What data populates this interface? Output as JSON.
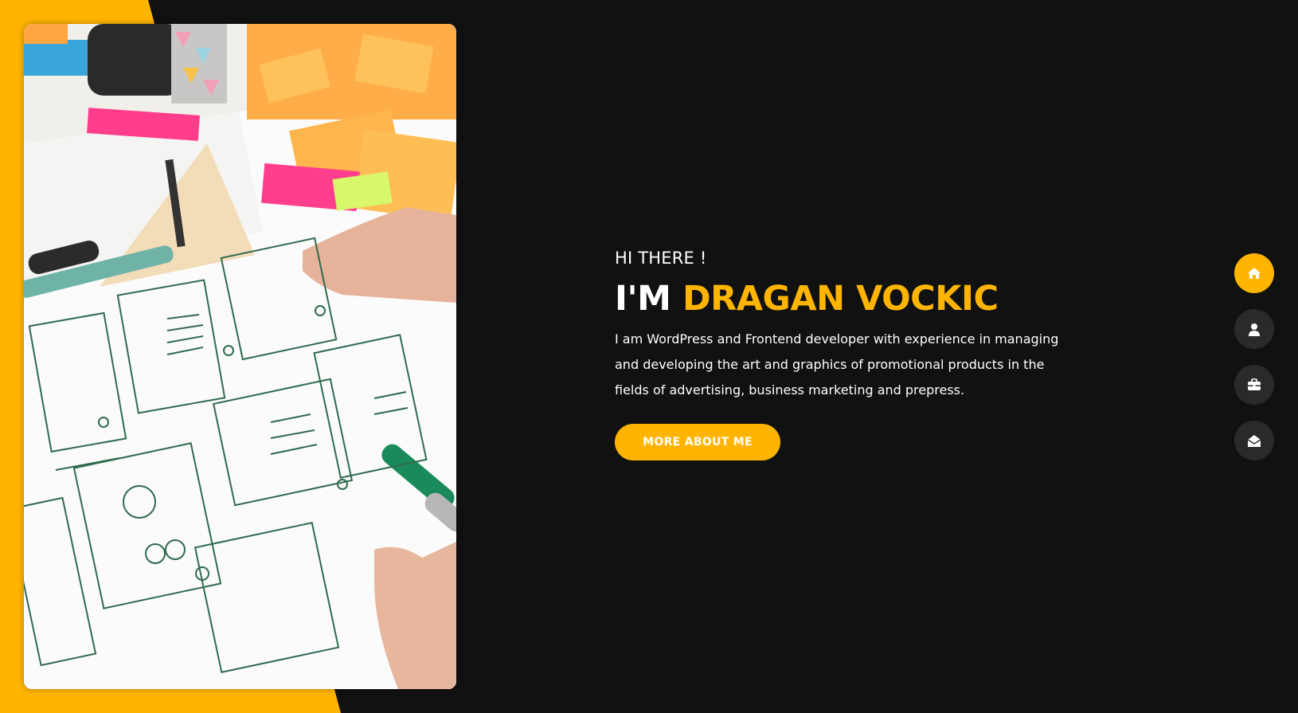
{
  "hero": {
    "greeting": "HI THERE !",
    "name_prefix": "I'M",
    "name_highlight": "DRAGAN VOCKIC",
    "description": "I am WordPress and Frontend developer with experience in managing and developing the art and graphics of promotional products in the fields of advertising, business marketing and prepress.",
    "cta_label": "MORE ABOUT ME",
    "image_icon": "wireframe-sketch-photo"
  },
  "nav": {
    "items": [
      {
        "icon": "home-icon",
        "active": true
      },
      {
        "icon": "user-icon",
        "active": false
      },
      {
        "icon": "briefcase-icon",
        "active": false
      },
      {
        "icon": "envelope-open-icon",
        "active": false
      }
    ]
  },
  "colors": {
    "accent": "#ffb400",
    "background": "#111111",
    "nav_inactive": "#2b2a2a",
    "text": "#ffffff"
  }
}
